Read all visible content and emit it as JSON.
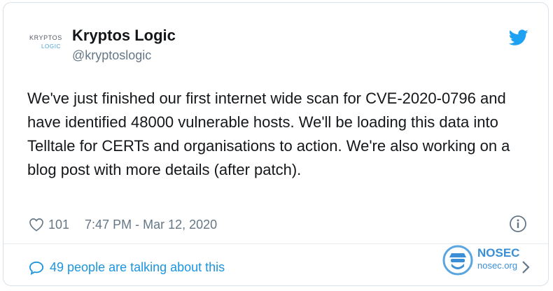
{
  "author": {
    "avatar_line1": "KRYPTOS",
    "avatar_line2": "LOGIC",
    "name": "Kryptos Logic",
    "handle": "@kryptoslogic"
  },
  "tweet": {
    "text": "We've just finished our first internet wide scan for CVE-2020-0796 and have identified 48000 vulnerable hosts. We'll be loading this data into Telltale for CERTs and organisations to action. We're also working on a blog post with more details (after patch).",
    "likes": "101",
    "timestamp": "7:47 PM - Mar 12, 2020"
  },
  "footer": {
    "talking": "49 people are talking about this"
  },
  "watermark": {
    "brand": "NOSEC",
    "domain": "nosec.org"
  },
  "icons": {
    "platform": "twitter-bird-icon",
    "like": "heart-icon",
    "info": "info-icon",
    "reply": "speech-bubble-icon",
    "chevron": "chevron-right-icon"
  },
  "colors": {
    "accent": "#1da1f2",
    "link": "#1b95e0",
    "muted": "#657786",
    "text": "#14171a"
  }
}
